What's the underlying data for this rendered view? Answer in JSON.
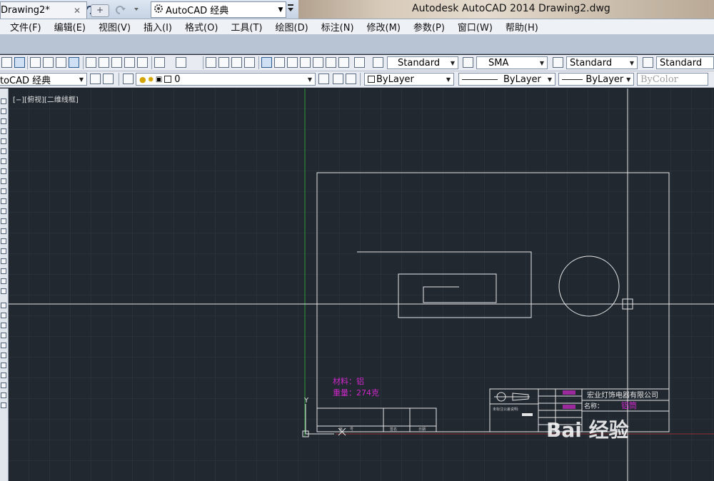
{
  "titlebar": {
    "workspace": "AutoCAD 经典",
    "app_title": "Autodesk AutoCAD 2014     Drawing2.dwg"
  },
  "menu": [
    "文件(F)",
    "编辑(E)",
    "视图(V)",
    "插入(I)",
    "格式(O)",
    "工具(T)",
    "绘图(D)",
    "标注(N)",
    "修改(M)",
    "参数(P)",
    "窗口(W)",
    "帮助(H)"
  ],
  "tabs": {
    "active": "Drawing2*",
    "close_glyph": "✕",
    "new_glyph": "+"
  },
  "toolbar1": {
    "text_style": "Standard",
    "dim_style": "SMA",
    "table_style": "Standard",
    "multileader_style": "Standard"
  },
  "toolbar2": {
    "workspace": "toCAD 经典",
    "layer": "0",
    "color": "ByLayer",
    "linetype": "ByLayer",
    "lineweight": "ByLayer",
    "plotstyle": "ByColor"
  },
  "viewport_label": "[−][俯视][二维线框]",
  "drawing": {
    "material": "材料：铝",
    "weight": "重量：274克",
    "company": "宏业灯饰电器有限公司",
    "name_label": "名称：",
    "name_value": "铝筒",
    "tolerance_note": "未标注公差说明:",
    "left_block_cells": [
      "序",
      "号",
      "签名",
      "日期"
    ],
    "ucs_y": "Y"
  },
  "colors": {
    "canvas": "#212830",
    "grid": "#2e3743",
    "geometry": "#e6e6e6",
    "annotation_pink": "#d028cc",
    "y_axis_green": "#2f9a3a"
  },
  "watermark": "Bai 经验"
}
